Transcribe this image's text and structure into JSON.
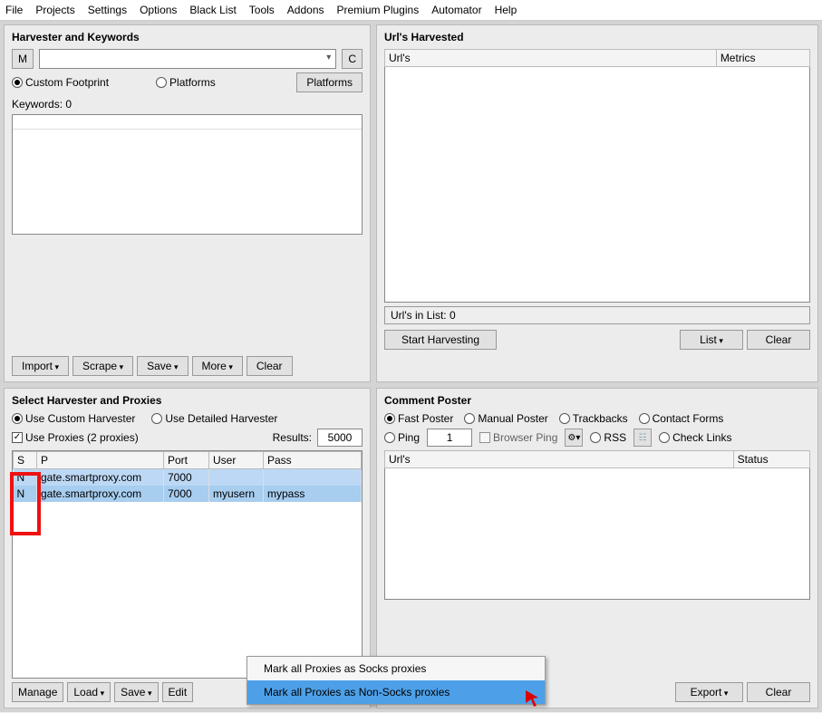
{
  "menu": [
    "File",
    "Projects",
    "Settings",
    "Options",
    "Black List",
    "Tools",
    "Addons",
    "Premium Plugins",
    "Automator",
    "Help"
  ],
  "harvester": {
    "title": "Harvester and Keywords",
    "m_btn": "M",
    "c_btn": "C",
    "custom_footprint": "Custom Footprint",
    "platforms_radio": "Platforms",
    "platforms_btn": "Platforms",
    "keywords_label": "Keywords:  0",
    "import": "Import",
    "scrape": "Scrape",
    "save": "Save",
    "more": "More",
    "clear": "Clear"
  },
  "urls": {
    "title": "Url's Harvested",
    "col_url": "Url's",
    "col_metrics": "Metrics",
    "in_list": "Url's in List: 0",
    "start": "Start Harvesting",
    "list": "List",
    "clear": "Clear"
  },
  "proxies": {
    "title": "Select Harvester and Proxies",
    "use_custom": "Use Custom Harvester",
    "use_detailed": "Use Detailed Harvester",
    "use_proxies": "Use Proxies  (2 proxies)",
    "results_label": "Results:",
    "results_value": "5000",
    "cols": {
      "s": "S",
      "p": "P",
      "port": "Port",
      "user": "User",
      "pass": "Pass"
    },
    "rows": [
      {
        "s": "N",
        "p": "gate.smartproxy.com",
        "port": "7000",
        "user": "",
        "pass": ""
      },
      {
        "s": "N",
        "p": "gate.smartproxy.com",
        "port": "7000",
        "user": "myusern",
        "pass": "mypass"
      }
    ],
    "manage": "Manage",
    "load": "Load",
    "save": "Save",
    "edit": "Edit"
  },
  "poster": {
    "title": "Comment Poster",
    "fast": "Fast Poster",
    "manual": "Manual Poster",
    "trackbacks": "Trackbacks",
    "contact": "Contact Forms",
    "ping": "Ping",
    "ping_val": "1",
    "browser_ping": "Browser Ping",
    "rss": "RSS",
    "check_links": "Check Links",
    "col_url": "Url's",
    "col_status": "Status",
    "export": "Export",
    "clear": "Clear"
  },
  "context": {
    "item1": "Mark all Proxies as Socks proxies",
    "item2": "Mark all Proxies as Non-Socks proxies"
  }
}
